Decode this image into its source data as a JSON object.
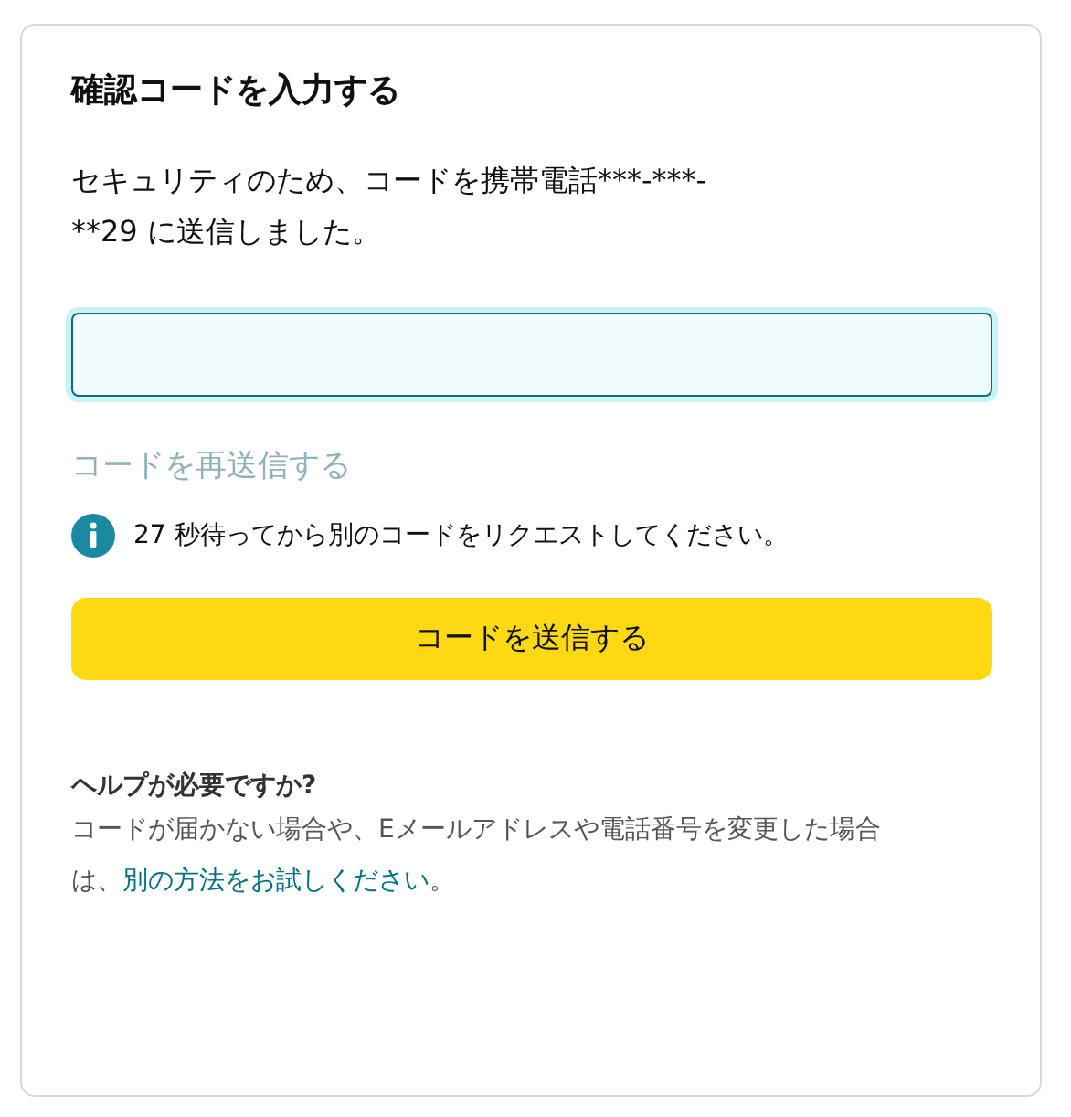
{
  "title": "確認コードを入力する",
  "description": "セキュリティのため、コードを携帯電話***-***-**29 に送信しました。",
  "resend_link": {
    "label": "コードを再送信する",
    "disabled": true
  },
  "notice": {
    "kind": "info",
    "text": "27 秒待ってから別のコードをリクエストしてください。"
  },
  "submit_button": {
    "label": "コードを送信する"
  },
  "help": {
    "heading": "ヘルプが必要ですか?",
    "text_before": "コードが届かない場合や、Eメールアドレスや電話番号を変更した場合は、",
    "link": "別の方法をお試しください",
    "text_after": "。"
  }
}
